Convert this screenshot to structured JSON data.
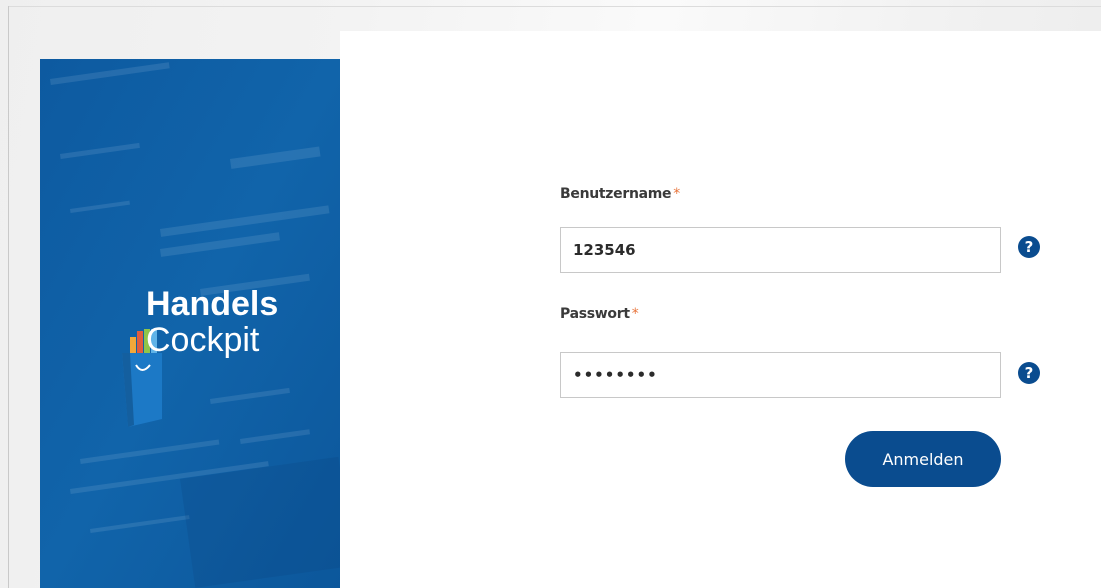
{
  "brand": {
    "line1": "Handels",
    "line2": "Cockpit"
  },
  "form": {
    "username": {
      "label": "Benutzername",
      "required_mark": "*",
      "value": "123546",
      "help_icon": "question-circle-icon",
      "help_glyph": "?"
    },
    "password": {
      "label": "Passwort",
      "required_mark": "*",
      "value": "••••••••",
      "help_icon": "question-circle-icon",
      "help_glyph": "?"
    },
    "submit_label": "Anmelden"
  },
  "colors": {
    "brand_blue": "#0f5ea3",
    "button_blue": "#0a4c8f",
    "required_orange": "#e8743b"
  }
}
